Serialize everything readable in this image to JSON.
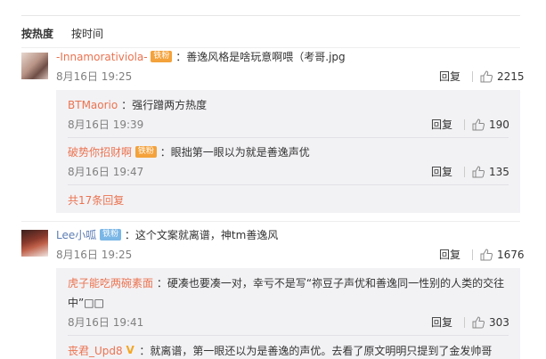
{
  "sort": {
    "hot": "按热度",
    "time": "按时间"
  },
  "comments": [
    {
      "user": "-Innamorativiola-",
      "badge": "铁粉",
      "text": "：善逸风格是啥玩意啊喂（考哥.jpg",
      "time": "8月16日 19:25",
      "reply_label": "回复",
      "likes": "2215",
      "replies": [
        {
          "user": "BTMaorio",
          "text": "：强行蹭两方热度",
          "time": "8月16日 19:39",
          "reply_label": "回复",
          "likes": "190"
        },
        {
          "user": "破势你招财啊",
          "badge": "铁粉",
          "text": "：眼拙第一眼以为就是善逸声优",
          "time": "8月16日 19:47",
          "reply_label": "回复",
          "likes": "135"
        }
      ],
      "more": "共17条回复"
    },
    {
      "user": "Lee小呱",
      "badge": "铁粉",
      "text": "：这个文案就离谱，神tm善逸风",
      "time": "8月16日 19:25",
      "reply_label": "回复",
      "likes": "1676",
      "replies": [
        {
          "user": "虎子能吃两碗素面",
          "text": "：硬凑也要凑一对，幸亏不是写“祢豆子声优和善逸同一性别的人类的交往",
          "text2": "中”□□",
          "time": "8月16日 19:41",
          "reply_label": "回复",
          "likes": "303"
        },
        {
          "user": "丧君_Upd8",
          "v": "V",
          "text": "：就离谱，第一眼还以为是善逸的声优。去看了原文明明只提到了金发帅哥"
        }
      ]
    }
  ],
  "colors": {
    "name": "#eb7350",
    "accent_blue": "#5d7db4",
    "reply_bg": "#f2f2f5",
    "meta": "#808080"
  },
  "icons": {
    "like": "thumb-up-icon",
    "fan_badge": "fan-badge-icon",
    "verified": "v-verified-icon"
  }
}
